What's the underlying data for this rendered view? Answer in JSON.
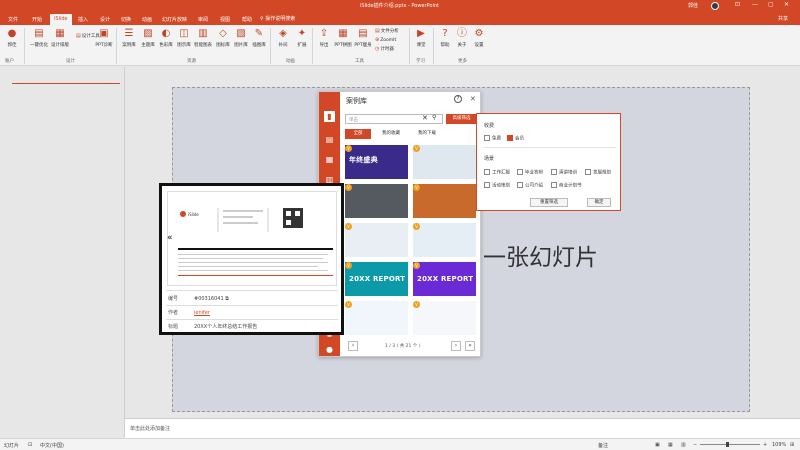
{
  "window": {
    "doc_title": "iSlide插件介绍.pptx  -  PowerPoint",
    "user": "郭佳",
    "controls": [
      "⊡",
      "—",
      "▢",
      "✕"
    ]
  },
  "tabs": [
    {
      "label": "文件"
    },
    {
      "label": "开始"
    },
    {
      "label": "iSlide",
      "active": true
    },
    {
      "label": "插入"
    },
    {
      "label": "设计"
    },
    {
      "label": "切换"
    },
    {
      "label": "动画"
    },
    {
      "label": "幻灯片放映"
    },
    {
      "label": "审阅"
    },
    {
      "label": "视图"
    },
    {
      "label": "帮助"
    }
  ],
  "tell_me": "操作说明搜索",
  "share": "共享",
  "ribbon": {
    "groups": [
      {
        "label": "账户"
      },
      {
        "label": "设计"
      },
      {
        "label": "资源"
      },
      {
        "label": "动画"
      },
      {
        "label": "工具"
      },
      {
        "label": "学习"
      },
      {
        "label": "更多"
      }
    ],
    "buttons": [
      {
        "label": "郭佳",
        "icon": "●"
      },
      {
        "label": "一键优化",
        "icon": "▤"
      },
      {
        "label": "设计排版",
        "icon": "▦"
      },
      {
        "label": "PPT诊断",
        "icon": "▣"
      },
      {
        "label": "案例库",
        "icon": "☰"
      },
      {
        "label": "主题库",
        "icon": "▨"
      },
      {
        "label": "色彩库",
        "icon": "◐"
      },
      {
        "label": "图示库",
        "icon": "◫"
      },
      {
        "label": "智能图表",
        "icon": "▥"
      },
      {
        "label": "图标库",
        "icon": "◇"
      },
      {
        "label": "图片库",
        "icon": "▧"
      },
      {
        "label": "插图库",
        "icon": "✎"
      },
      {
        "label": "补间",
        "icon": "◈"
      },
      {
        "label": "扩展",
        "icon": "✦"
      },
      {
        "label": "导出",
        "icon": "⇪"
      },
      {
        "label": "PPT拼图",
        "icon": "▦"
      },
      {
        "label": "PPT瘦身",
        "icon": "▤"
      },
      {
        "label": "课堂",
        "icon": "▶"
      },
      {
        "label": "帮助",
        "icon": "?"
      },
      {
        "label": "关于",
        "icon": "ⓘ"
      },
      {
        "label": "设置",
        "icon": "⚙"
      }
    ],
    "small_buttons": [
      {
        "label": "设计工具"
      },
      {
        "label": "文件分析"
      },
      {
        "label": "ZoomIt"
      },
      {
        "label": "计时器"
      }
    ]
  },
  "slide": {
    "title": "一张幻灯片"
  },
  "notes": {
    "placeholder": "单击此处添加备注"
  },
  "status": {
    "slide_count": "幻灯片",
    "lang": "中文(中国)",
    "notes_btn": "备注",
    "zoom": "109%"
  },
  "case_panel": {
    "title": "案例库",
    "search_placeholder": "单击",
    "filter_button": "高级筛选",
    "tabs": [
      {
        "label": "全部",
        "active": true
      },
      {
        "label": "我的收藏"
      },
      {
        "label": "我的下载"
      }
    ],
    "cards": [
      {
        "text": "年终盛典",
        "color": "#3a2a8a"
      },
      {
        "text": "",
        "color": "#dfe8ef"
      },
      {
        "text": "",
        "color": "#555a60"
      },
      {
        "text": "",
        "color": "#c86a2b"
      },
      {
        "text": "",
        "color": "#e8eef3"
      },
      {
        "text": "",
        "color": "#e6eef5"
      },
      {
        "text": "",
        "color": "#e8f0f6"
      },
      {
        "text": "",
        "color": "#ffffff"
      },
      {
        "text": "20XX REPORT",
        "color": "#0d9aa8"
      },
      {
        "text": "20XX REPORT",
        "color": "#6a2bd6"
      },
      {
        "text": "",
        "color": "#f0f6fb"
      },
      {
        "text": "",
        "color": "#f5f7fa"
      }
    ],
    "pager": {
      "text": "1 / 3 ( 共 21 个 )"
    }
  },
  "filter_popup": {
    "charge_label": "收费",
    "charge_options": [
      {
        "label": "免费",
        "checked": false
      },
      {
        "label": "会员",
        "checked": true
      }
    ],
    "scene_label": "场景",
    "scene_options": [
      {
        "label": "工作汇报"
      },
      {
        "label": "毕业答辩"
      },
      {
        "label": "演讲培训"
      },
      {
        "label": "发展规划"
      },
      {
        "label": "活动策划"
      },
      {
        "label": "公司介绍"
      },
      {
        "label": "商业计划书"
      }
    ],
    "reset_btn": "重置筛选",
    "ok_btn": "确定"
  },
  "preview": {
    "brand": "iSlide",
    "id_label": "编号",
    "id_value": "#00316041",
    "author_label": "作者",
    "author_value": "ienifer",
    "tag_label": "标题",
    "tag_value": "20XX个人年终总结工作报告"
  }
}
